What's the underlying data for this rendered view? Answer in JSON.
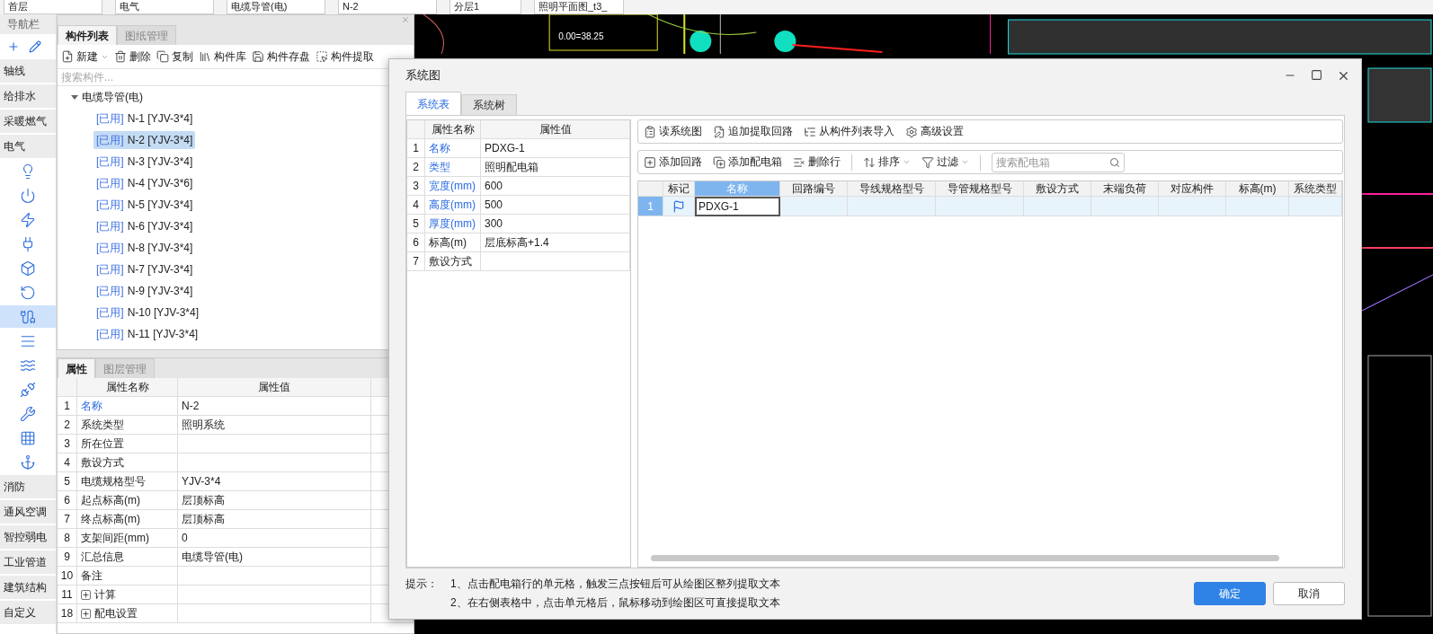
{
  "top_bar": {
    "dropdowns": [
      "首层",
      "电气",
      "电缆导管(电)",
      "N-2",
      "分层1",
      "照明平面图_t3_"
    ]
  },
  "nav": {
    "title": "导航栏",
    "categories": [
      {
        "label": "轴线"
      },
      {
        "label": "给排水"
      },
      {
        "label": "采暖燃气"
      },
      {
        "label": "电气",
        "tools": [
          {
            "selected": false
          },
          {
            "selected": false
          },
          {
            "selected": false
          },
          {
            "selected": false
          },
          {
            "selected": false
          },
          {
            "selected": false
          },
          {
            "selected": true
          },
          {
            "selected": false
          },
          {
            "selected": false
          },
          {
            "selected": false
          },
          {
            "selected": false
          },
          {
            "selected": false
          },
          {
            "selected": false
          }
        ]
      },
      {
        "label": "消防"
      },
      {
        "label": "通风空调"
      },
      {
        "label": "智控弱电"
      },
      {
        "label": "工业管道"
      },
      {
        "label": "建筑结构"
      },
      {
        "label": "自定义"
      }
    ]
  },
  "component_panel": {
    "tabs": [
      {
        "label": "构件列表",
        "selected": true
      },
      {
        "label": "图纸管理",
        "selected": false
      }
    ],
    "toolbar": [
      {
        "label": "新建",
        "dropdown": true
      },
      {
        "label": "删除",
        "dropdown": false
      },
      {
        "label": "复制",
        "dropdown": false
      },
      {
        "label": "构件库",
        "dropdown": false
      },
      {
        "label": "构件存盘",
        "dropdown": false
      },
      {
        "label": "构件提取",
        "dropdown": false
      }
    ],
    "search": {
      "placeholder": "搜索构件..."
    },
    "tree": [
      {
        "label": "电缆导管(电)",
        "expanded": true,
        "children": [
          {
            "tag": "[已用]",
            "label": "N-1 [YJV-3*4]",
            "selected": false
          },
          {
            "tag": "[已用]",
            "label": "N-2 [YJV-3*4]",
            "selected": true
          },
          {
            "tag": "[已用]",
            "label": "N-3 [YJV-3*4]",
            "selected": false
          },
          {
            "tag": "[已用]",
            "label": "N-4 [YJV-3*6]",
            "selected": false
          },
          {
            "tag": "[已用]",
            "label": "N-5 [YJV-3*4]",
            "selected": false
          },
          {
            "tag": "[已用]",
            "label": "N-6 [YJV-3*4]",
            "selected": false
          },
          {
            "tag": "[已用]",
            "label": "N-8 [YJV-3*4]",
            "selected": false
          },
          {
            "tag": "[已用]",
            "label": "N-7 [YJV-3*4]",
            "selected": false
          },
          {
            "tag": "[已用]",
            "label": "N-9 [YJV-3*4]",
            "selected": false
          },
          {
            "tag": "[已用]",
            "label": "N-10 [YJV-3*4]",
            "selected": false
          },
          {
            "tag": "[已用]",
            "label": "N-11 [YJV-3*4]",
            "selected": false
          }
        ]
      }
    ]
  },
  "property_panel": {
    "tabs": [
      {
        "label": "属性",
        "selected": true
      },
      {
        "label": "图层管理",
        "selected": false
      }
    ],
    "columns": [
      "属性名称",
      "属性值"
    ],
    "rows": [
      {
        "num": "1",
        "name": "名称",
        "value": "N-2",
        "linked": true
      },
      {
        "num": "2",
        "name": "系统类型",
        "value": "照明系统",
        "linked": false
      },
      {
        "num": "3",
        "name": "所在位置",
        "linked": false
      },
      {
        "num": "4",
        "name": "敷设方式",
        "linked": false
      },
      {
        "num": "5",
        "name": "电缆规格型号",
        "value": "YJV-3*4",
        "linked": false
      },
      {
        "num": "6",
        "name": "起点标高(m)",
        "value": "层顶标高",
        "linked": false
      },
      {
        "num": "7",
        "name": "终点标高(m)",
        "value": "层顶标高",
        "linked": false
      },
      {
        "num": "8",
        "name": "支架间距(mm)",
        "value": "0",
        "linked": false
      },
      {
        "num": "9",
        "name": "汇总信息",
        "value": "电缆导管(电)",
        "linked": false
      },
      {
        "num": "10",
        "name": "备注",
        "linked": false
      },
      {
        "num": "11",
        "name": "计算",
        "linked": false,
        "expanded": false
      },
      {
        "num": "18",
        "name": "配电设置",
        "linked": false,
        "expanded": false
      }
    ]
  },
  "canvas": {
    "labels": [
      "0.00=38.25"
    ]
  },
  "dialog": {
    "title": "系统图",
    "tabs": [
      {
        "label": "系统表",
        "selected": true
      },
      {
        "label": "系统树",
        "selected": false
      }
    ],
    "properties": {
      "columns": [
        "属性名称",
        "属性值"
      ],
      "rows": [
        {
          "num": "1",
          "name": "名称",
          "value": "PDXG-1",
          "linked": true
        },
        {
          "num": "2",
          "name": "类型",
          "value": "照明配电箱",
          "linked": true
        },
        {
          "num": "3",
          "name": "宽度(mm)",
          "value": "600",
          "linked": true
        },
        {
          "num": "4",
          "name": "高度(mm)",
          "value": "500",
          "linked": true
        },
        {
          "num": "5",
          "name": "厚度(mm)",
          "value": "300",
          "linked": true
        },
        {
          "num": "6",
          "name": "标高(m)",
          "value": "层底标高+1.4",
          "linked": false
        },
        {
          "num": "7",
          "name": "敷设方式",
          "linked": false
        }
      ]
    },
    "toolbar_1": [
      {
        "label": "读系统图",
        "dropdown": false
      },
      {
        "label": "追加提取回路",
        "dropdown": false
      },
      {
        "label": "从构件列表导入",
        "dropdown": false
      },
      {
        "label": "高级设置",
        "dropdown": false
      }
    ],
    "toolbar_2": [
      {
        "label": "添加回路",
        "dropdown": false
      },
      {
        "label": "添加配电箱",
        "dropdown": false
      },
      {
        "label": "删除行",
        "dropdown": false
      },
      {
        "label": "排序",
        "dropdown": true
      },
      {
        "label": "过滤",
        "dropdown": true
      }
    ],
    "search": {
      "placeholder": "搜索配电箱"
    },
    "grid": {
      "columns": [
        {
          "label": "标记",
          "selected": false
        },
        {
          "label": "名称",
          "selected": true
        },
        {
          "label": "回路编号",
          "selected": false
        },
        {
          "label": "导线规格型号",
          "selected": false
        },
        {
          "label": "导管规格型号",
          "selected": false
        },
        {
          "label": "敷设方式",
          "selected": false
        },
        {
          "label": "末端负荷",
          "selected": false
        },
        {
          "label": "对应构件",
          "selected": false
        },
        {
          "label": "标高(m)",
          "selected": false
        },
        {
          "label": "系统类型",
          "selected": false
        }
      ],
      "rows": [
        {
          "num": "1",
          "marked": true,
          "cells": [
            "",
            "PDXG-1",
            "",
            "",
            "",
            "",
            "",
            "",
            "",
            ""
          ],
          "selected": true
        }
      ]
    },
    "hint_label": "提示：",
    "hints": [
      "1、点击配电箱行的单元格，触发三点按钮后可从绘图区整列提取文本",
      "2、在右侧表格中，点击单元格后，鼠标移动到绘图区可直接提取文本"
    ],
    "buttons": [
      {
        "label": "确定",
        "kind": "primary"
      },
      {
        "label": "取消",
        "kind": "default"
      }
    ]
  }
}
